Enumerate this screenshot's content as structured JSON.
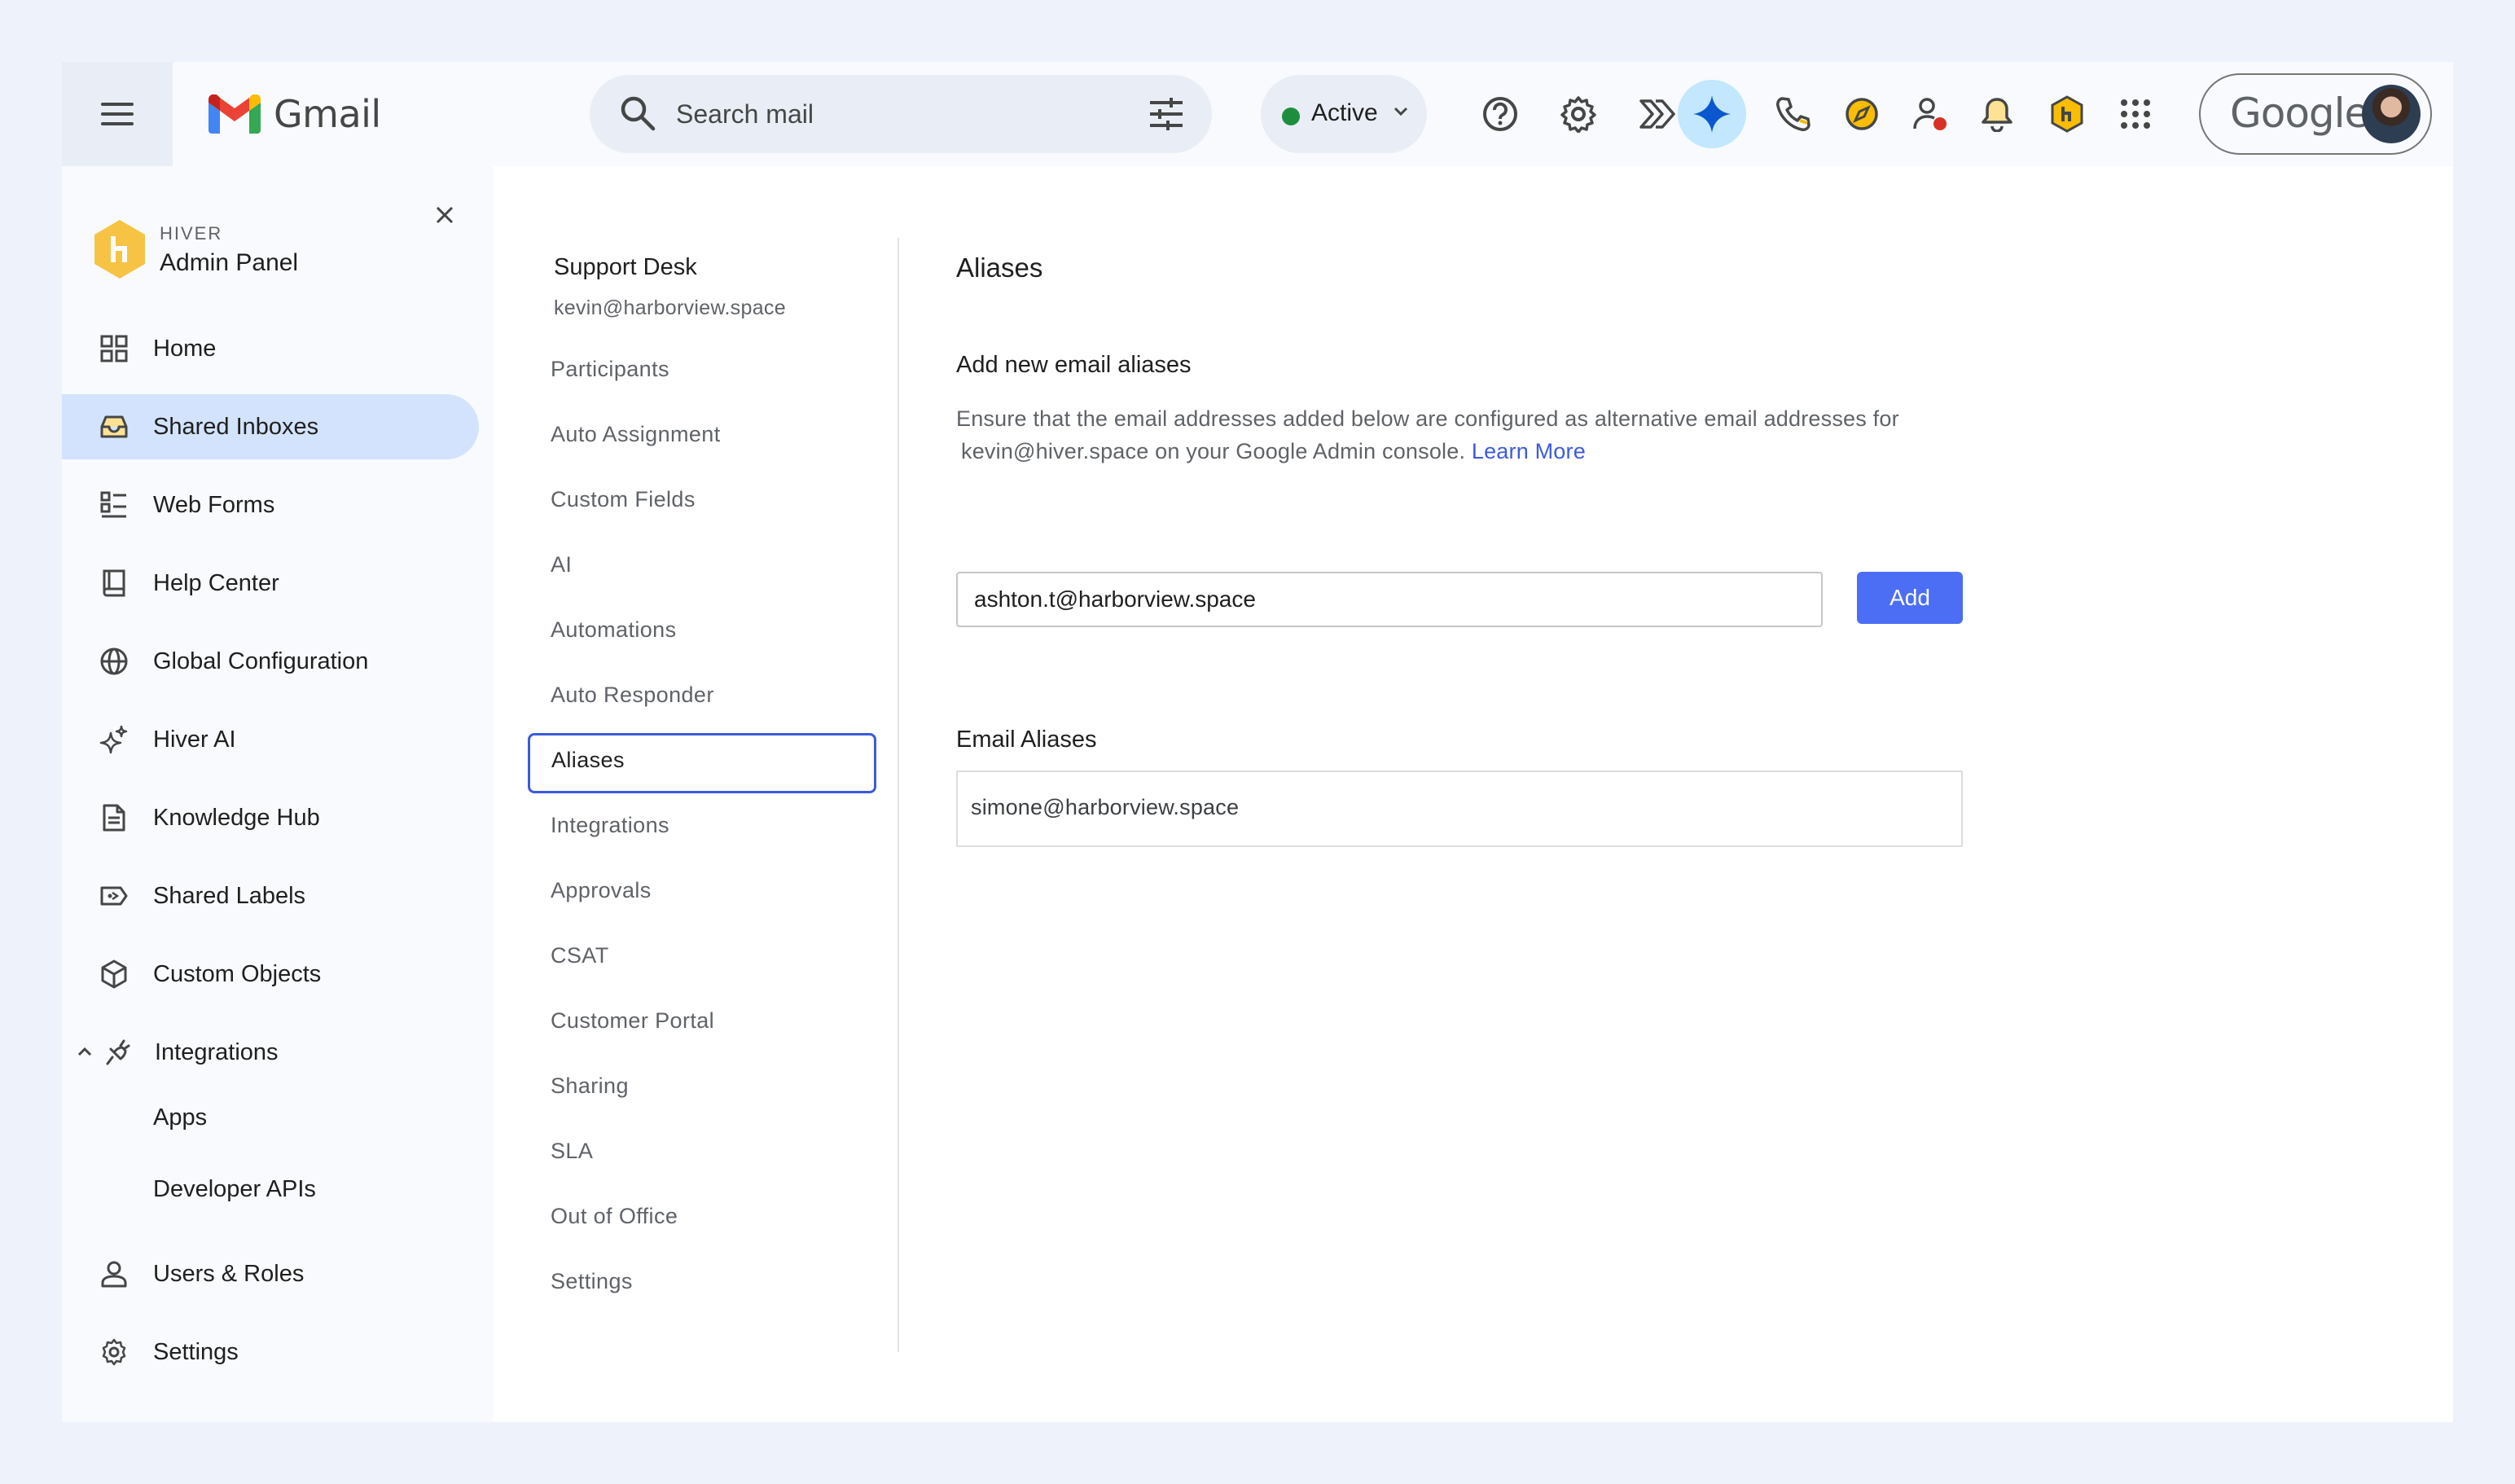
{
  "header": {
    "app_name": "Gmail",
    "search": {
      "placeholder": "Search mail"
    },
    "status": {
      "label": "Active",
      "color": "#1e8e3e"
    },
    "account": {
      "brand": "Google"
    },
    "icons": [
      "menu-icon",
      "search-icon",
      "tune-icon",
      "help-icon",
      "settings-icon",
      "chevron-double-icon",
      "gemini-icon",
      "phone-icon",
      "compass-icon",
      "user-alert-icon",
      "bell-icon",
      "hiver-icon",
      "apps-grid-icon"
    ]
  },
  "sidebar": {
    "brand": "HIVER",
    "title": "Admin Panel",
    "items": [
      {
        "label": "Home",
        "icon": "grid-icon"
      },
      {
        "label": "Shared Inboxes",
        "icon": "inbox-icon",
        "active": true
      },
      {
        "label": "Web Forms",
        "icon": "form-icon"
      },
      {
        "label": "Help Center",
        "icon": "book-icon"
      },
      {
        "label": "Global Configuration",
        "icon": "globe-icon"
      },
      {
        "label": "Hiver AI",
        "icon": "sparkle-icon"
      },
      {
        "label": "Knowledge Hub",
        "icon": "document-icon"
      },
      {
        "label": "Shared Labels",
        "icon": "label-icon"
      },
      {
        "label": "Custom Objects",
        "icon": "cube-icon"
      },
      {
        "label": "Integrations",
        "icon": "plug-icon",
        "expanded": true
      },
      {
        "label": "Users & Roles",
        "icon": "user-icon"
      },
      {
        "label": "Settings",
        "icon": "gear-icon"
      }
    ],
    "integrations_children": [
      "Apps",
      "Developer APIs"
    ]
  },
  "inbox": {
    "name": "Support Desk",
    "email": "kevin@harborview.space",
    "menu": [
      "Participants",
      "Auto Assignment",
      "Custom Fields",
      "AI",
      "Automations",
      "Auto Responder",
      "Aliases",
      "Integrations",
      "Approvals",
      "CSAT",
      "Customer Portal",
      "Sharing",
      "SLA",
      "Out of Office",
      "Settings"
    ],
    "active": "Aliases"
  },
  "aliases": {
    "title": "Aliases",
    "add_title": "Add new email aliases",
    "description_line1": "Ensure that the email addresses added below are configured as alternative email addresses for",
    "description_line2": "kevin@hiver.space on your Google Admin console.",
    "learn_more": "Learn More",
    "input_value": "ashton.t@harborview.space",
    "add_button": "Add",
    "list_title": "Email Aliases",
    "list": [
      "simone@harborview.space"
    ]
  },
  "colors": {
    "accent": "#4c6ef5",
    "active_nav": "#d3e3fd",
    "link": "#3b5bdb",
    "hiver_yellow": "#f6c344"
  }
}
